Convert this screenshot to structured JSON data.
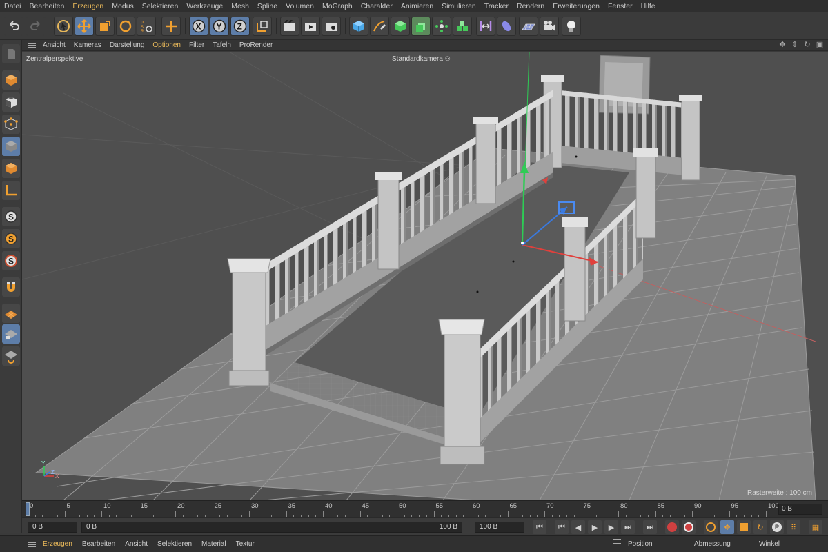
{
  "menu": [
    "Datei",
    "Bearbeiten",
    "Erzeugen",
    "Modus",
    "Selektieren",
    "Werkzeuge",
    "Mesh",
    "Spline",
    "Volumen",
    "MoGraph",
    "Charakter",
    "Animieren",
    "Simulieren",
    "Tracker",
    "Rendern",
    "Erweiterungen",
    "Fenster",
    "Hilfe"
  ],
  "viewport_menu": [
    "Ansicht",
    "Kameras",
    "Darstellung",
    "Optionen",
    "Filter",
    "Tafeln",
    "ProRender"
  ],
  "viewport": {
    "projection": "Zentralperspektive",
    "camera": "Standardkamera",
    "grid_info": "Rasterweite : 100 cm",
    "axis_y": "Y",
    "axis_z": "Z",
    "axis_x": "X"
  },
  "toolbar_icons": [
    "undo-icon",
    "redo-icon",
    "live-selection-icon",
    "move-icon",
    "scale-icon",
    "rotate-icon",
    "psr-icon",
    "add-icon",
    "x-axis-icon",
    "y-axis-icon",
    "z-axis-icon",
    "coordinate-system-icon",
    "render-view-icon",
    "render-picture-viewer-icon",
    "render-settings-icon",
    "cube-icon",
    "pen-icon",
    "subdivision-icon",
    "extrude-icon",
    "array-icon",
    "cloner-icon",
    "deformer-icon",
    "environment-icon",
    "floor-icon",
    "camera-icon",
    "light-icon"
  ],
  "timeline": {
    "ticks": [
      "0",
      "5",
      "10",
      "15",
      "20",
      "25",
      "30",
      "35",
      "40",
      "45",
      "50",
      "55",
      "60",
      "65",
      "70",
      "75",
      "80",
      "85",
      "90",
      "95",
      "100"
    ],
    "current_frame": "0 B"
  },
  "transport": {
    "start_frame": "0 B",
    "range_start": "0 B",
    "range_end": "100 B",
    "end_frame": "100 B"
  },
  "bottom_menu": [
    "Erzeugen",
    "Bearbeiten",
    "Ansicht",
    "Selektieren",
    "Material",
    "Textur"
  ],
  "attributes_headers": [
    "Position",
    "Abmessung",
    "Winkel"
  ],
  "colors": {
    "accent": "#e8b85a",
    "active_tool": "#5d7da8",
    "axis_x": "#e0403c",
    "axis_y": "#3cc25a",
    "axis_z": "#3a7ae0"
  }
}
